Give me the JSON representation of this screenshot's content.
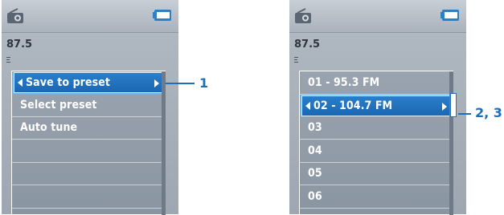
{
  "left_screen": {
    "frequency": "87.5",
    "menu": [
      "Save to preset",
      "Select preset",
      "Auto tune",
      "",
      "",
      ""
    ],
    "callout": "1"
  },
  "right_screen": {
    "frequency": "87.5",
    "presets": [
      "01 - 95.3 FM",
      "02 - 104.7 FM",
      "03",
      "04",
      "05",
      "06"
    ],
    "callout": "2, 3"
  },
  "icons": {
    "radio": "radio-icon",
    "battery": "battery-icon"
  },
  "colors": {
    "highlight": "#1b67b3",
    "callout": "#1e6fb8"
  }
}
